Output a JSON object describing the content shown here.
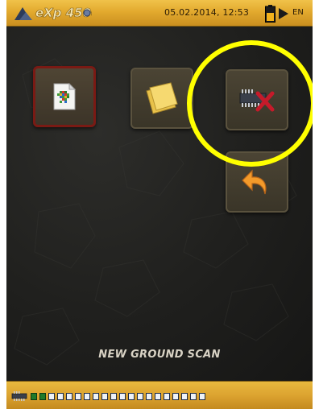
{
  "status_bar": {
    "brand": "eXp 4500",
    "datetime": "05.02.2014, 12:53",
    "language": "EN"
  },
  "menu": {
    "tiles": [
      {
        "name": "new-ground-scan",
        "icon": "scan-file-icon",
        "selected": true
      },
      {
        "name": "files",
        "icon": "folders-icon",
        "selected": false
      },
      {
        "name": "erase-memory",
        "icon": "memory-delete-icon",
        "selected": false
      },
      {
        "name": "back",
        "icon": "back-arrow-icon",
        "selected": false
      }
    ],
    "mode_label": "NEW GROUND SCAN"
  },
  "memory_bar": {
    "total_slots": 20,
    "used_slots": 2
  },
  "colors": {
    "accent_gold": "#e3aa2e",
    "highlight": "#ffff00",
    "selected_border": "#7a1a14"
  }
}
